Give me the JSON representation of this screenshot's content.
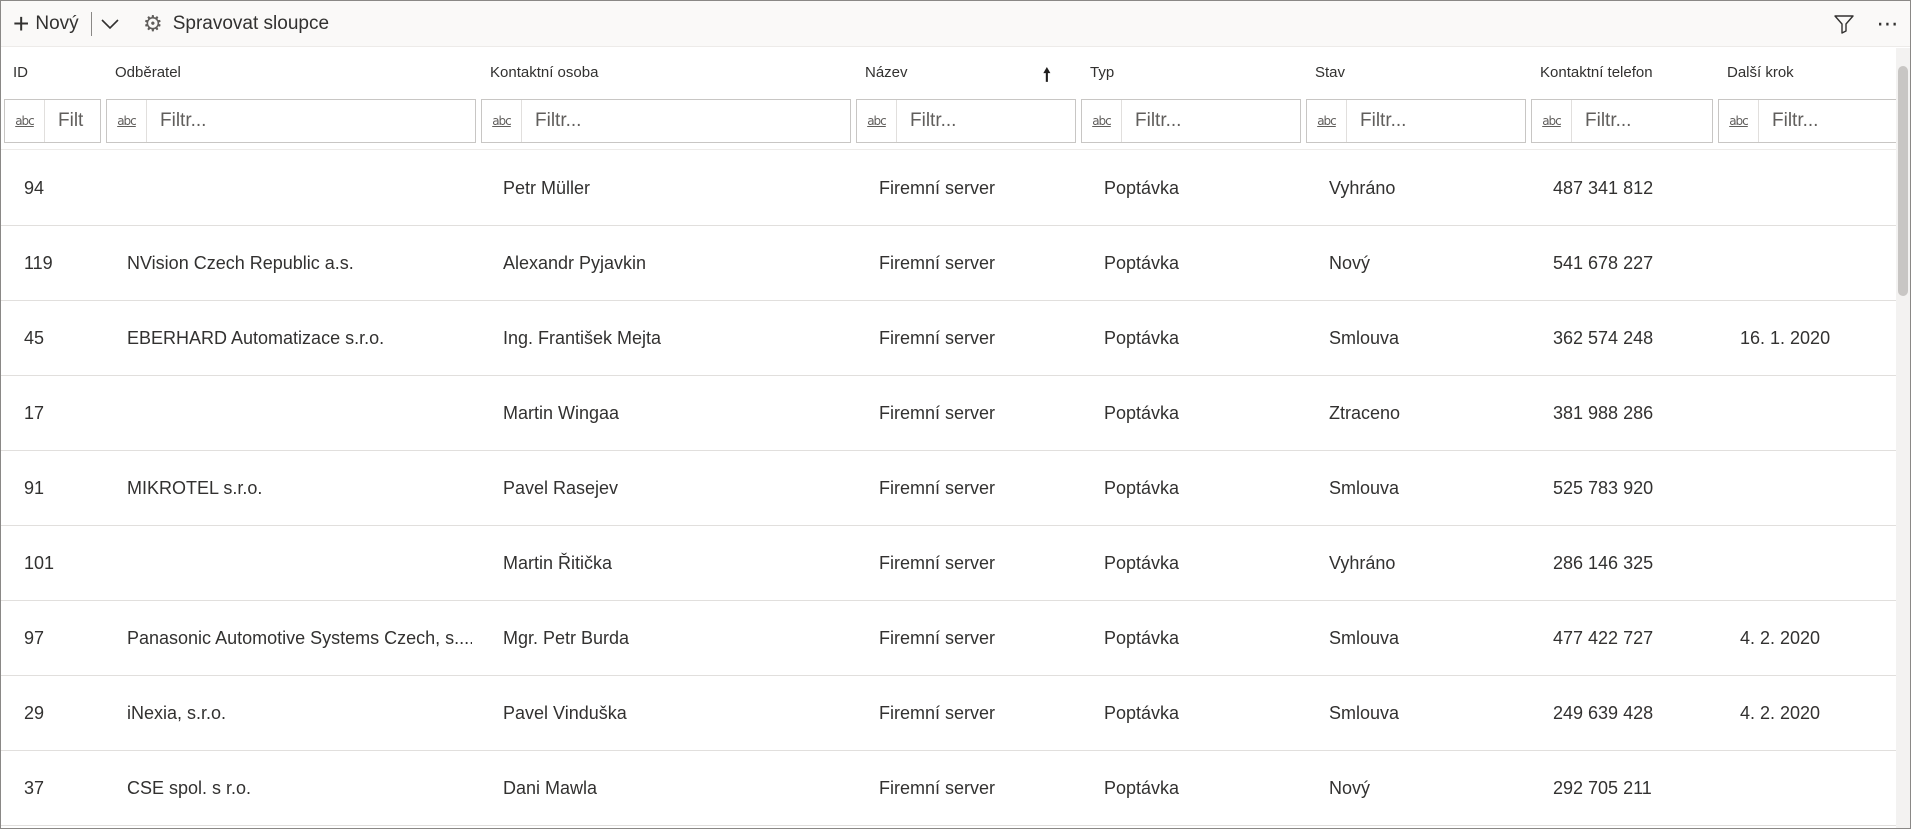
{
  "toolbar": {
    "new_label": "Nový",
    "manage_columns_label": "Spravovat sloupce",
    "icons": {
      "new": "plus-icon",
      "dropdown": "chevron-down-icon",
      "manage": "gear-icon",
      "filter": "filter-icon",
      "more": "more-icon"
    }
  },
  "columns": [
    {
      "key": "id",
      "label": "ID"
    },
    {
      "key": "customer",
      "label": "Odběratel"
    },
    {
      "key": "contact",
      "label": "Kontaktní osoba"
    },
    {
      "key": "name",
      "label": "Název",
      "sorted": "ascending"
    },
    {
      "key": "type",
      "label": "Typ"
    },
    {
      "key": "status",
      "label": "Stav"
    },
    {
      "key": "phone",
      "label": "Kontaktní telefon"
    },
    {
      "key": "next_step",
      "label": "Další krok"
    }
  ],
  "filters": {
    "placeholder": "Filtr...",
    "first_visible": "Filt",
    "icon_label": "abc"
  },
  "rows": [
    {
      "id": "94",
      "customer": "",
      "contact": "Petr Müller",
      "name": "Firemní server",
      "type": "Poptávka",
      "status": "Vyhráno",
      "phone": "487 341 812",
      "next_step": ""
    },
    {
      "id": "119",
      "customer": "NVision Czech Republic a.s.",
      "contact": "Alexandr Pyjavkin",
      "name": "Firemní server",
      "type": "Poptávka",
      "status": "Nový",
      "phone": "541 678 227",
      "next_step": ""
    },
    {
      "id": "45",
      "customer": "EBERHARD Automatizace s.r.o.",
      "contact": "Ing. František Mejta",
      "name": "Firemní server",
      "type": "Poptávka",
      "status": "Smlouva",
      "phone": "362 574 248",
      "next_step": "16. 1. 2020"
    },
    {
      "id": "17",
      "customer": "",
      "contact": "Martin Wingaa",
      "name": "Firemní server",
      "type": "Poptávka",
      "status": "Ztraceno",
      "phone": "381 988 286",
      "next_step": ""
    },
    {
      "id": "91",
      "customer": "MIKROTEL s.r.o.",
      "contact": "Pavel Rasejev",
      "name": "Firemní server",
      "type": "Poptávka",
      "status": "Smlouva",
      "phone": "525 783 920",
      "next_step": ""
    },
    {
      "id": "101",
      "customer": "",
      "contact": "Martin Řitička",
      "name": "Firemní server",
      "type": "Poptávka",
      "status": "Vyhráno",
      "phone": "286 146 325",
      "next_step": ""
    },
    {
      "id": "97",
      "customer": "Panasonic Automotive Systems Czech, s....",
      "contact": "Mgr. Petr Burda",
      "name": "Firemní server",
      "type": "Poptávka",
      "status": "Smlouva",
      "phone": "477 422 727",
      "next_step": "4. 2. 2020"
    },
    {
      "id": "29",
      "customer": "iNexia, s.r.o.",
      "contact": "Pavel Vinduška",
      "name": "Firemní server",
      "type": "Poptávka",
      "status": "Smlouva",
      "phone": "249 639 428",
      "next_step": "4. 2. 2020"
    },
    {
      "id": "37",
      "customer": "CSE spol. s r.o.",
      "contact": "Dani Mawla",
      "name": "Firemní server",
      "type": "Poptávka",
      "status": "Nový",
      "phone": "292 705 211",
      "next_step": ""
    }
  ]
}
